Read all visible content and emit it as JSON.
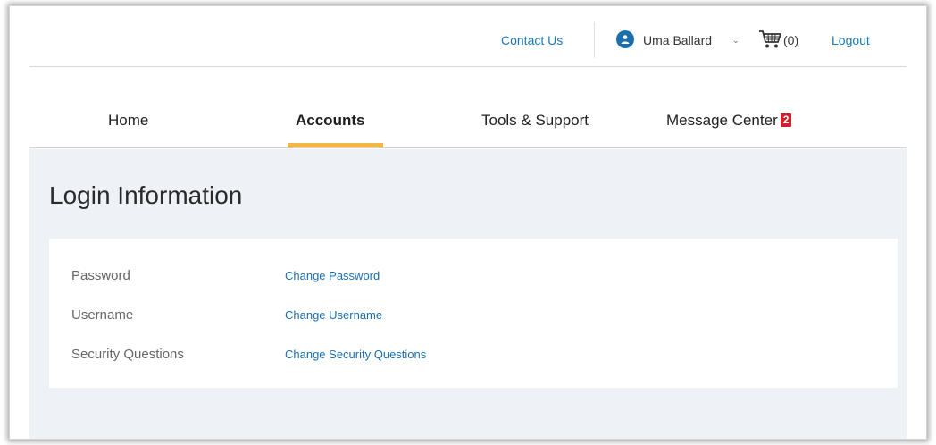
{
  "header": {
    "contact_label": "Contact Us",
    "user_name": "Uma Ballard",
    "user_chevron": "⌄",
    "cart_count": "(0)",
    "logout_label": "Logout"
  },
  "icons": {
    "avatar": "user-icon",
    "cart": "shopping-cart-icon",
    "chevron": "chevron-down-icon"
  },
  "nav": {
    "items": [
      {
        "label": "Home"
      },
      {
        "label": "Accounts",
        "active": true
      },
      {
        "label": "Tools & Support"
      },
      {
        "label": "Message Center",
        "badge": "2"
      }
    ]
  },
  "page": {
    "title": "Login Information"
  },
  "login_info": {
    "rows": [
      {
        "label": "Password",
        "action": "Change Password"
      },
      {
        "label": "Username",
        "action": "Change Username"
      },
      {
        "label": "Security Questions",
        "action": "Change Security Questions"
      }
    ]
  },
  "colors": {
    "link": "#1a7ab6",
    "active_underline": "#f3b543",
    "badge": "#d0202e",
    "avatar": "#1b6fad",
    "content_background": "#eef2f6"
  }
}
